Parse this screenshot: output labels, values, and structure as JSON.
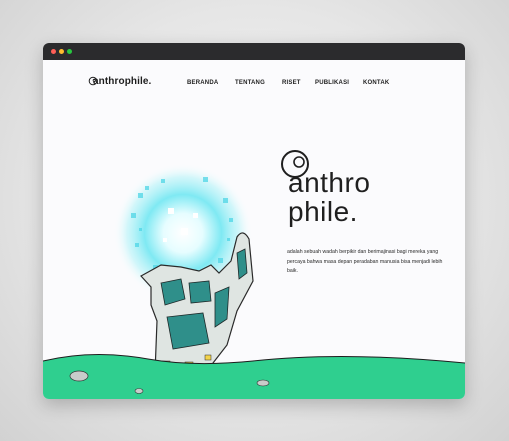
{
  "site": {
    "logo_text": "anthrophile.",
    "nav": [
      {
        "label": "BERANDA"
      },
      {
        "label": "TENTANG"
      },
      {
        "label": "RISET"
      },
      {
        "label": "PUBLIKASI"
      },
      {
        "label": "KONTAK"
      }
    ]
  },
  "hero": {
    "title_line1": "anthro",
    "title_line2": "phile.",
    "description": "adalah sebuah wadah berpikir dan berimajinasi bagi mereka yang percaya bahwa masa depan peradaban manusia bisa menjadi lebih baik."
  },
  "colors": {
    "titlebar": "#2b2b2d",
    "ground_green": "#2fcf8f",
    "energy_cyan": "#5ee4f0",
    "text_dark": "#1f1f1f"
  }
}
